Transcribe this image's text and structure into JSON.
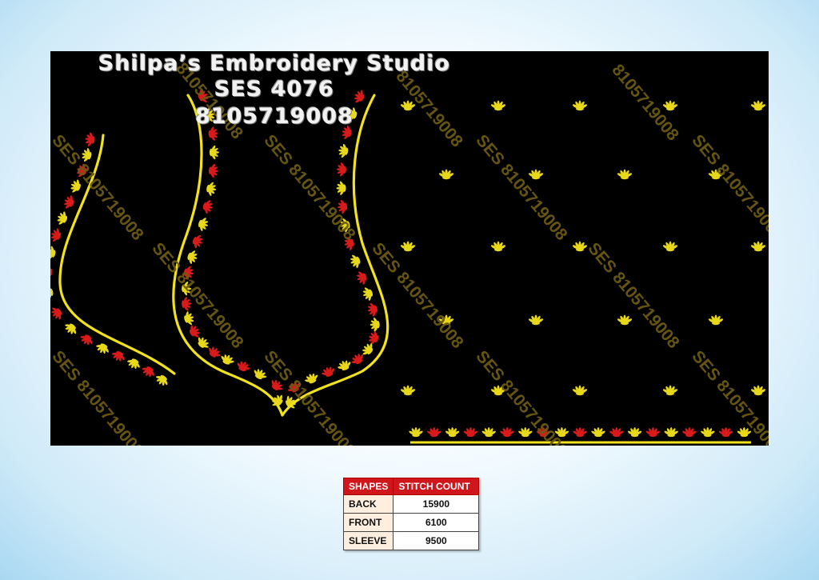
{
  "design": {
    "title": "Shilpa’s Embroidery Studio",
    "code": "SES  4076",
    "phone": "8105719008",
    "watermark_long": "SES 8105719008",
    "watermark_short": "8105719008",
    "colors": {
      "background": "#000000",
      "outline": "#f2e21c",
      "accent": "#d91a1a",
      "motif": "#e8d81a",
      "watermark": "#6b5a12"
    }
  },
  "table": {
    "headers": [
      "SHAPES",
      "STITCH COUNT"
    ],
    "rows": [
      {
        "shape": "BACK",
        "count": "15900"
      },
      {
        "shape": "FRONT",
        "count": "6100"
      },
      {
        "shape": "SLEEVE",
        "count": "9500"
      }
    ]
  }
}
